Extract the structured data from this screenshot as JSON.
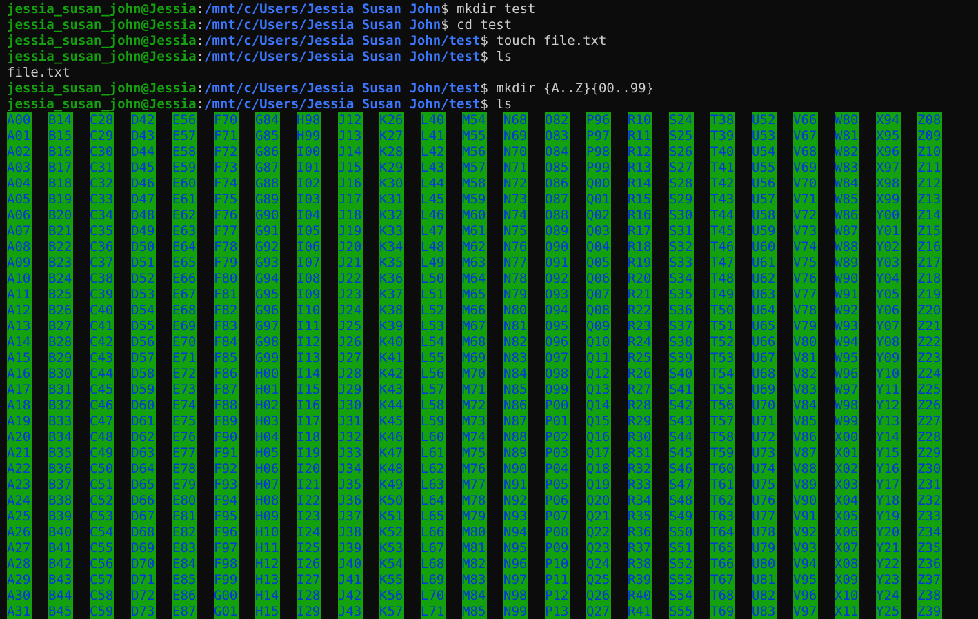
{
  "prompt": {
    "user_host": "jessia_susan_john@Jessia",
    "colon": ":",
    "dollar": "$"
  },
  "history": [
    {
      "type": "prompt",
      "path": "/mnt/c/Users/Jessia Susan John",
      "command": " mkdir test"
    },
    {
      "type": "prompt",
      "path": "/mnt/c/Users/Jessia Susan John",
      "command": " cd test"
    },
    {
      "type": "prompt",
      "path": "/mnt/c/Users/Jessia Susan John/test",
      "command": " touch file.txt"
    },
    {
      "type": "prompt",
      "path": "/mnt/c/Users/Jessia Susan John/test",
      "command": " ls"
    },
    {
      "type": "output",
      "text": "file.txt"
    },
    {
      "type": "prompt",
      "path": "/mnt/c/Users/Jessia Susan John/test",
      "command": " mkdir {A..Z}{00..99}"
    },
    {
      "type": "prompt",
      "path": "/mnt/c/Users/Jessia Susan John/test",
      "command": " ls"
    }
  ],
  "ls_columns": [
    [
      "A00",
      "A01",
      "A02",
      "A03",
      "A04",
      "A05",
      "A06",
      "A07",
      "A08",
      "A09",
      "A10",
      "A11",
      "A12",
      "A13",
      "A14",
      "A15",
      "A16",
      "A17",
      "A18",
      "A19",
      "A20",
      "A21",
      "A22",
      "A23",
      "A24",
      "A25",
      "A26",
      "A27",
      "A28",
      "A29",
      "A30",
      "A31"
    ],
    [
      "B14",
      "B15",
      "B16",
      "B17",
      "B18",
      "B19",
      "B20",
      "B21",
      "B22",
      "B23",
      "B24",
      "B25",
      "B26",
      "B27",
      "B28",
      "B29",
      "B30",
      "B31",
      "B32",
      "B33",
      "B34",
      "B35",
      "B36",
      "B37",
      "B38",
      "B39",
      "B40",
      "B41",
      "B42",
      "B43",
      "B44",
      "B45"
    ],
    [
      "C28",
      "C29",
      "C30",
      "C31",
      "C32",
      "C33",
      "C34",
      "C35",
      "C36",
      "C37",
      "C38",
      "C39",
      "C40",
      "C41",
      "C42",
      "C43",
      "C44",
      "C45",
      "C46",
      "C47",
      "C48",
      "C49",
      "C50",
      "C51",
      "C52",
      "C53",
      "C54",
      "C55",
      "C56",
      "C57",
      "C58",
      "C59"
    ],
    [
      "D42",
      "D43",
      "D44",
      "D45",
      "D46",
      "D47",
      "D48",
      "D49",
      "D50",
      "D51",
      "D52",
      "D53",
      "D54",
      "D55",
      "D56",
      "D57",
      "D58",
      "D59",
      "D60",
      "D61",
      "D62",
      "D63",
      "D64",
      "D65",
      "D66",
      "D67",
      "D68",
      "D69",
      "D70",
      "D71",
      "D72",
      "D73"
    ],
    [
      "E56",
      "E57",
      "E58",
      "E59",
      "E60",
      "E61",
      "E62",
      "E63",
      "E64",
      "E65",
      "E66",
      "E67",
      "E68",
      "E69",
      "E70",
      "E71",
      "E72",
      "E73",
      "E74",
      "E75",
      "E76",
      "E77",
      "E78",
      "E79",
      "E80",
      "E81",
      "E82",
      "E83",
      "E84",
      "E85",
      "E86",
      "E87"
    ],
    [
      "F70",
      "F71",
      "F72",
      "F73",
      "F74",
      "F75",
      "F76",
      "F77",
      "F78",
      "F79",
      "F80",
      "F81",
      "F82",
      "F83",
      "F84",
      "F85",
      "F86",
      "F87",
      "F88",
      "F89",
      "F90",
      "F91",
      "F92",
      "F93",
      "F94",
      "F95",
      "F96",
      "F97",
      "F98",
      "F99",
      "G00",
      "G01"
    ],
    [
      "G84",
      "G85",
      "G86",
      "G87",
      "G88",
      "G89",
      "G90",
      "G91",
      "G92",
      "G93",
      "G94",
      "G95",
      "G96",
      "G97",
      "G98",
      "G99",
      "H00",
      "H01",
      "H02",
      "H03",
      "H04",
      "H05",
      "H06",
      "H07",
      "H08",
      "H09",
      "H10",
      "H11",
      "H12",
      "H13",
      "H14",
      "H15"
    ],
    [
      "H98",
      "H99",
      "I00",
      "I01",
      "I02",
      "I03",
      "I04",
      "I05",
      "I06",
      "I07",
      "I08",
      "I09",
      "I10",
      "I11",
      "I12",
      "I13",
      "I14",
      "I15",
      "I16",
      "I17",
      "I18",
      "I19",
      "I20",
      "I21",
      "I22",
      "I23",
      "I24",
      "I25",
      "I26",
      "I27",
      "I28",
      "I29"
    ],
    [
      "J12",
      "J13",
      "J14",
      "J15",
      "J16",
      "J17",
      "J18",
      "J19",
      "J20",
      "J21",
      "J22",
      "J23",
      "J24",
      "J25",
      "J26",
      "J27",
      "J28",
      "J29",
      "J30",
      "J31",
      "J32",
      "J33",
      "J34",
      "J35",
      "J36",
      "J37",
      "J38",
      "J39",
      "J40",
      "J41",
      "J42",
      "J43"
    ],
    [
      "K26",
      "K27",
      "K28",
      "K29",
      "K30",
      "K31",
      "K32",
      "K33",
      "K34",
      "K35",
      "K36",
      "K37",
      "K38",
      "K39",
      "K40",
      "K41",
      "K42",
      "K43",
      "K44",
      "K45",
      "K46",
      "K47",
      "K48",
      "K49",
      "K50",
      "K51",
      "K52",
      "K53",
      "K54",
      "K55",
      "K56",
      "K57"
    ],
    [
      "L40",
      "L41",
      "L42",
      "L43",
      "L44",
      "L45",
      "L46",
      "L47",
      "L48",
      "L49",
      "L50",
      "L51",
      "L52",
      "L53",
      "L54",
      "L55",
      "L56",
      "L57",
      "L58",
      "L59",
      "L60",
      "L61",
      "L62",
      "L63",
      "L64",
      "L65",
      "L66",
      "L67",
      "L68",
      "L69",
      "L70",
      "L71"
    ],
    [
      "M54",
      "M55",
      "M56",
      "M57",
      "M58",
      "M59",
      "M60",
      "M61",
      "M62",
      "M63",
      "M64",
      "M65",
      "M66",
      "M67",
      "M68",
      "M69",
      "M70",
      "M71",
      "M72",
      "M73",
      "M74",
      "M75",
      "M76",
      "M77",
      "M78",
      "M79",
      "M80",
      "M81",
      "M82",
      "M83",
      "M84",
      "M85"
    ],
    [
      "N68",
      "N69",
      "N70",
      "N71",
      "N72",
      "N73",
      "N74",
      "N75",
      "N76",
      "N77",
      "N78",
      "N79",
      "N80",
      "N81",
      "N82",
      "N83",
      "N84",
      "N85",
      "N86",
      "N87",
      "N88",
      "N89",
      "N90",
      "N91",
      "N92",
      "N93",
      "N94",
      "N95",
      "N96",
      "N97",
      "N98",
      "N99"
    ],
    [
      "O82",
      "O83",
      "O84",
      "O85",
      "O86",
      "O87",
      "O88",
      "O89",
      "O90",
      "O91",
      "O92",
      "O93",
      "O94",
      "O95",
      "O96",
      "O97",
      "O98",
      "O99",
      "P00",
      "P01",
      "P02",
      "P03",
      "P04",
      "P05",
      "P06",
      "P07",
      "P08",
      "P09",
      "P10",
      "P11",
      "P12",
      "P13"
    ],
    [
      "P96",
      "P97",
      "P98",
      "P99",
      "Q00",
      "Q01",
      "Q02",
      "Q03",
      "Q04",
      "Q05",
      "Q06",
      "Q07",
      "Q08",
      "Q09",
      "Q10",
      "Q11",
      "Q12",
      "Q13",
      "Q14",
      "Q15",
      "Q16",
      "Q17",
      "Q18",
      "Q19",
      "Q20",
      "Q21",
      "Q22",
      "Q23",
      "Q24",
      "Q25",
      "Q26",
      "Q27"
    ],
    [
      "R10",
      "R11",
      "R12",
      "R13",
      "R14",
      "R15",
      "R16",
      "R17",
      "R18",
      "R19",
      "R20",
      "R21",
      "R22",
      "R23",
      "R24",
      "R25",
      "R26",
      "R27",
      "R28",
      "R29",
      "R30",
      "R31",
      "R32",
      "R33",
      "R34",
      "R35",
      "R36",
      "R37",
      "R38",
      "R39",
      "R40",
      "R41"
    ],
    [
      "S24",
      "S25",
      "S26",
      "S27",
      "S28",
      "S29",
      "S30",
      "S31",
      "S32",
      "S33",
      "S34",
      "S35",
      "S36",
      "S37",
      "S38",
      "S39",
      "S40",
      "S41",
      "S42",
      "S43",
      "S44",
      "S45",
      "S46",
      "S47",
      "S48",
      "S49",
      "S50",
      "S51",
      "S52",
      "S53",
      "S54",
      "S55"
    ],
    [
      "T38",
      "T39",
      "T40",
      "T41",
      "T42",
      "T43",
      "T44",
      "T45",
      "T46",
      "T47",
      "T48",
      "T49",
      "T50",
      "T51",
      "T52",
      "T53",
      "T54",
      "T55",
      "T56",
      "T57",
      "T58",
      "T59",
      "T60",
      "T61",
      "T62",
      "T63",
      "T64",
      "T65",
      "T66",
      "T67",
      "T68",
      "T69"
    ],
    [
      "U52",
      "U53",
      "U54",
      "U55",
      "U56",
      "U57",
      "U58",
      "U59",
      "U60",
      "U61",
      "U62",
      "U63",
      "U64",
      "U65",
      "U66",
      "U67",
      "U68",
      "U69",
      "U70",
      "U71",
      "U72",
      "U73",
      "U74",
      "U75",
      "U76",
      "U77",
      "U78",
      "U79",
      "U80",
      "U81",
      "U82",
      "U83"
    ],
    [
      "V66",
      "V67",
      "V68",
      "V69",
      "V70",
      "V71",
      "V72",
      "V73",
      "V74",
      "V75",
      "V76",
      "V77",
      "V78",
      "V79",
      "V80",
      "V81",
      "V82",
      "V83",
      "V84",
      "V85",
      "V86",
      "V87",
      "V88",
      "V89",
      "V90",
      "V91",
      "V92",
      "V93",
      "V94",
      "V95",
      "V96",
      "V97"
    ],
    [
      "W80",
      "W81",
      "W82",
      "W83",
      "W84",
      "W85",
      "W86",
      "W87",
      "W88",
      "W89",
      "W90",
      "W91",
      "W92",
      "W93",
      "W94",
      "W95",
      "W96",
      "W97",
      "W98",
      "W99",
      "X00",
      "X01",
      "X02",
      "X03",
      "X04",
      "X05",
      "X06",
      "X07",
      "X08",
      "X09",
      "X10",
      "X11"
    ],
    [
      "X94",
      "X95",
      "X96",
      "X97",
      "X98",
      "X99",
      "Y00",
      "Y01",
      "Y02",
      "Y03",
      "Y04",
      "Y05",
      "Y06",
      "Y07",
      "Y08",
      "Y09",
      "Y10",
      "Y11",
      "Y12",
      "Y13",
      "Y14",
      "Y15",
      "Y16",
      "Y17",
      "Y18",
      "Y19",
      "Y20",
      "Y21",
      "Y22",
      "Y23",
      "Y24",
      "Y25"
    ],
    [
      "Z08",
      "Z09",
      "Z10",
      "Z11",
      "Z12",
      "Z13",
      "Z14",
      "Z15",
      "Z16",
      "Z17",
      "Z18",
      "Z19",
      "Z20",
      "Z21",
      "Z22",
      "Z23",
      "Z24",
      "Z25",
      "Z26",
      "Z27",
      "Z28",
      "Z29",
      "Z30",
      "Z31",
      "Z32",
      "Z33",
      "Z34",
      "Z35",
      "Z36",
      "Z37",
      "Z38",
      "Z39"
    ]
  ],
  "colors": {
    "background": "#0c0c0c",
    "user_host": "#13a10e",
    "path": "#3b78ff",
    "text": "#cccccc",
    "dir_bg": "#13a10e",
    "dir_fg": "#0037da"
  }
}
